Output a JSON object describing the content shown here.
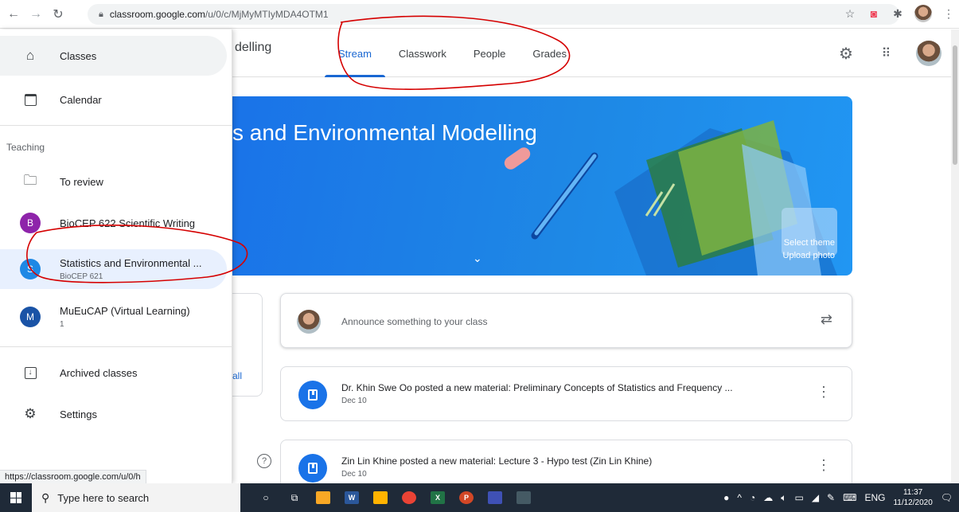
{
  "browser": {
    "url_host": "classroom.google.com",
    "url_path": "/u/0/c/MjMyMTIyMDA4OTM1",
    "status_url": "https://classroom.google.com/u/0/h"
  },
  "header": {
    "class_title_partial": "delling",
    "tabs": [
      {
        "label": "Stream"
      },
      {
        "label": "Classwork"
      },
      {
        "label": "People"
      },
      {
        "label": "Grades"
      }
    ]
  },
  "banner": {
    "title_partial": "s and Environmental Modelling",
    "select_theme": "Select theme",
    "upload_photo": "Upload photo"
  },
  "drawer": {
    "classes": "Classes",
    "calendar": "Calendar",
    "teaching_heading": "Teaching",
    "to_review": "To review",
    "courses": [
      {
        "letter": "B",
        "name": "BioCEP 622 Scientific Writing",
        "sub": "",
        "color": "#8e24aa"
      },
      {
        "letter": "S",
        "name": "Statistics and Environmental ...",
        "sub": "BioCEP 621",
        "color": "#1e88e5"
      },
      {
        "letter": "M",
        "name": "MuEuCAP (Virtual Learning)",
        "sub": "1",
        "color": "#1a53a6"
      }
    ],
    "archived": "Archived classes",
    "settings": "Settings"
  },
  "stream": {
    "side_link_partial": "all",
    "announce_placeholder": "Announce something to your class",
    "posts": [
      {
        "text": "Dr. Khin Swe Oo posted a new material: Preliminary Concepts of Statistics and Frequency ...",
        "date": "Dec 10"
      },
      {
        "text": "Zin Lin Khine posted a new material: Lecture 3 - Hypo test (Zin Lin Khine)",
        "date": "Dec 10"
      }
    ]
  },
  "taskbar": {
    "search_placeholder": "Type here to search",
    "lang": "ENG",
    "time": "11:37",
    "date": "11/12/2020"
  },
  "colors": {
    "accent": "#1967d2",
    "banner": "#1a73e8",
    "annotation": "#d50000"
  }
}
